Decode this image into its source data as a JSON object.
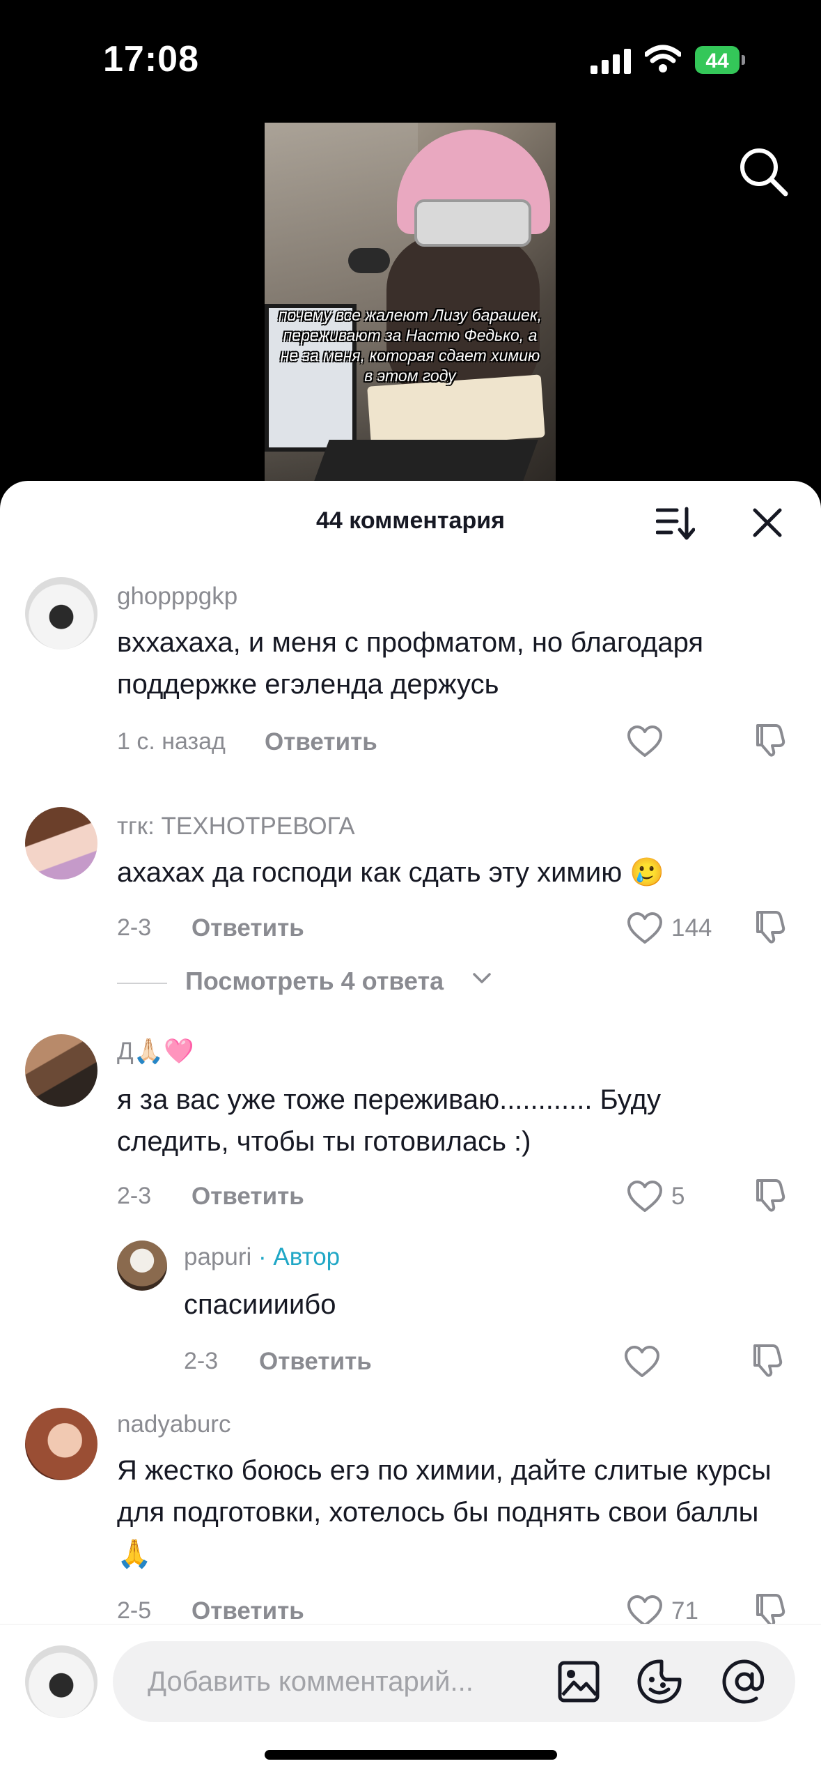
{
  "status_bar": {
    "time": "17:08",
    "battery": "44"
  },
  "video": {
    "overlay_text": "почему все жалеют Лизу барашек, переживают за Настю Федько, а не за меня, которая сдает химию в этом году"
  },
  "sheet": {
    "title": "44 комментария"
  },
  "comments": [
    {
      "username": "ghopppgkp",
      "text": "вххахаха, и меня с профматом, но благодаря поддержке егэленда держусь",
      "time": "1 с. назад",
      "reply_label": "Ответить",
      "likes": ""
    },
    {
      "username": "тгк: ТЕХНОТРЕВОГА",
      "text": "ахахах да господи как сдать эту химию 🥲",
      "time": "2-3",
      "reply_label": "Ответить",
      "likes": "144"
    },
    {
      "username": "Д🙏🏻🩷",
      "text": "я за вас уже тоже переживаю............ Буду следить, чтобы ты готовилась :)",
      "time": "2-3",
      "reply_label": "Ответить",
      "likes": "5"
    },
    {
      "username": "papuri",
      "author_badge": " · Автор",
      "text": "спасиииибо",
      "time": "2-3",
      "reply_label": "Ответить",
      "likes": ""
    },
    {
      "username": "nadyaburc",
      "text": "Я жестко боюсь егэ по химии, дайте слитые курсы для подготовки, хотелось бы поднять свои баллы 🙏",
      "time": "2-5",
      "reply_label": "Ответить",
      "likes": "71"
    }
  ],
  "view_replies": "Посмотреть 4 ответа",
  "input": {
    "placeholder": "Добавить комментарий..."
  },
  "colors": {
    "accent_author": "#20a7c6",
    "battery": "#34c759",
    "text_primary": "#161823",
    "text_secondary": "#8a8b91"
  },
  "icons": [
    "search-icon",
    "sort-icon",
    "close-icon",
    "heart-icon",
    "dislike-icon",
    "image-icon",
    "emoji-icon",
    "mention-icon"
  ]
}
